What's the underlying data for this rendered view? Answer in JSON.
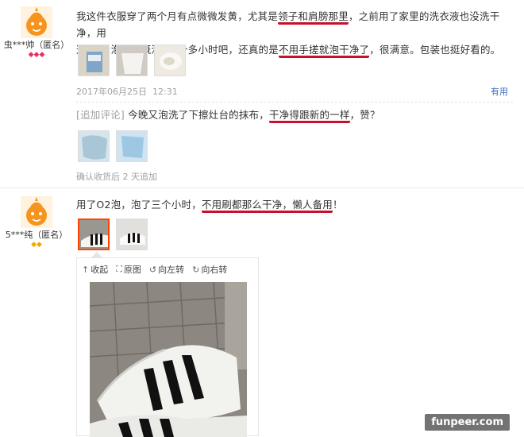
{
  "review1": {
    "username": "虫***帅（匿名）",
    "badges": "◆◆◆",
    "text_line1_a": "我这件衣服穿了两个月有点微微发黄，尤其是",
    "text_line1_b": "领子和肩膀那里",
    "text_line1_c": "，之前用了家里的洗衣液也没洗干净，用",
    "text_line2_a": "这个O2泡，大概泡了2个多小时吧，还真的是",
    "text_line2_b": "不用手搓就泡干净了",
    "text_line2_c": "，很满意。包装也挺好看的。",
    "date": "2017年06月25日",
    "time": "12:31",
    "useful": "有用",
    "followup_tag": "[追加评论]",
    "followup_a": "今晚又泡洗了下擦灶台的抹布，",
    "followup_b": "干净得跟新的一样",
    "followup_c": "，赞？",
    "followup_meta": "确认收货后 2 天追加"
  },
  "review2": {
    "username": "5***纯（匿名）",
    "badges": "◆◆",
    "text_a": "用了O2泡，泡了三个小时，",
    "text_b": "不用刷都那么干净，懒人备用",
    "text_c": "！",
    "toolbar": {
      "collapse": "收起",
      "original": "原图",
      "rotate_left": "向左转",
      "rotate_right": "向右转"
    }
  },
  "watermark": "funpeer.com"
}
